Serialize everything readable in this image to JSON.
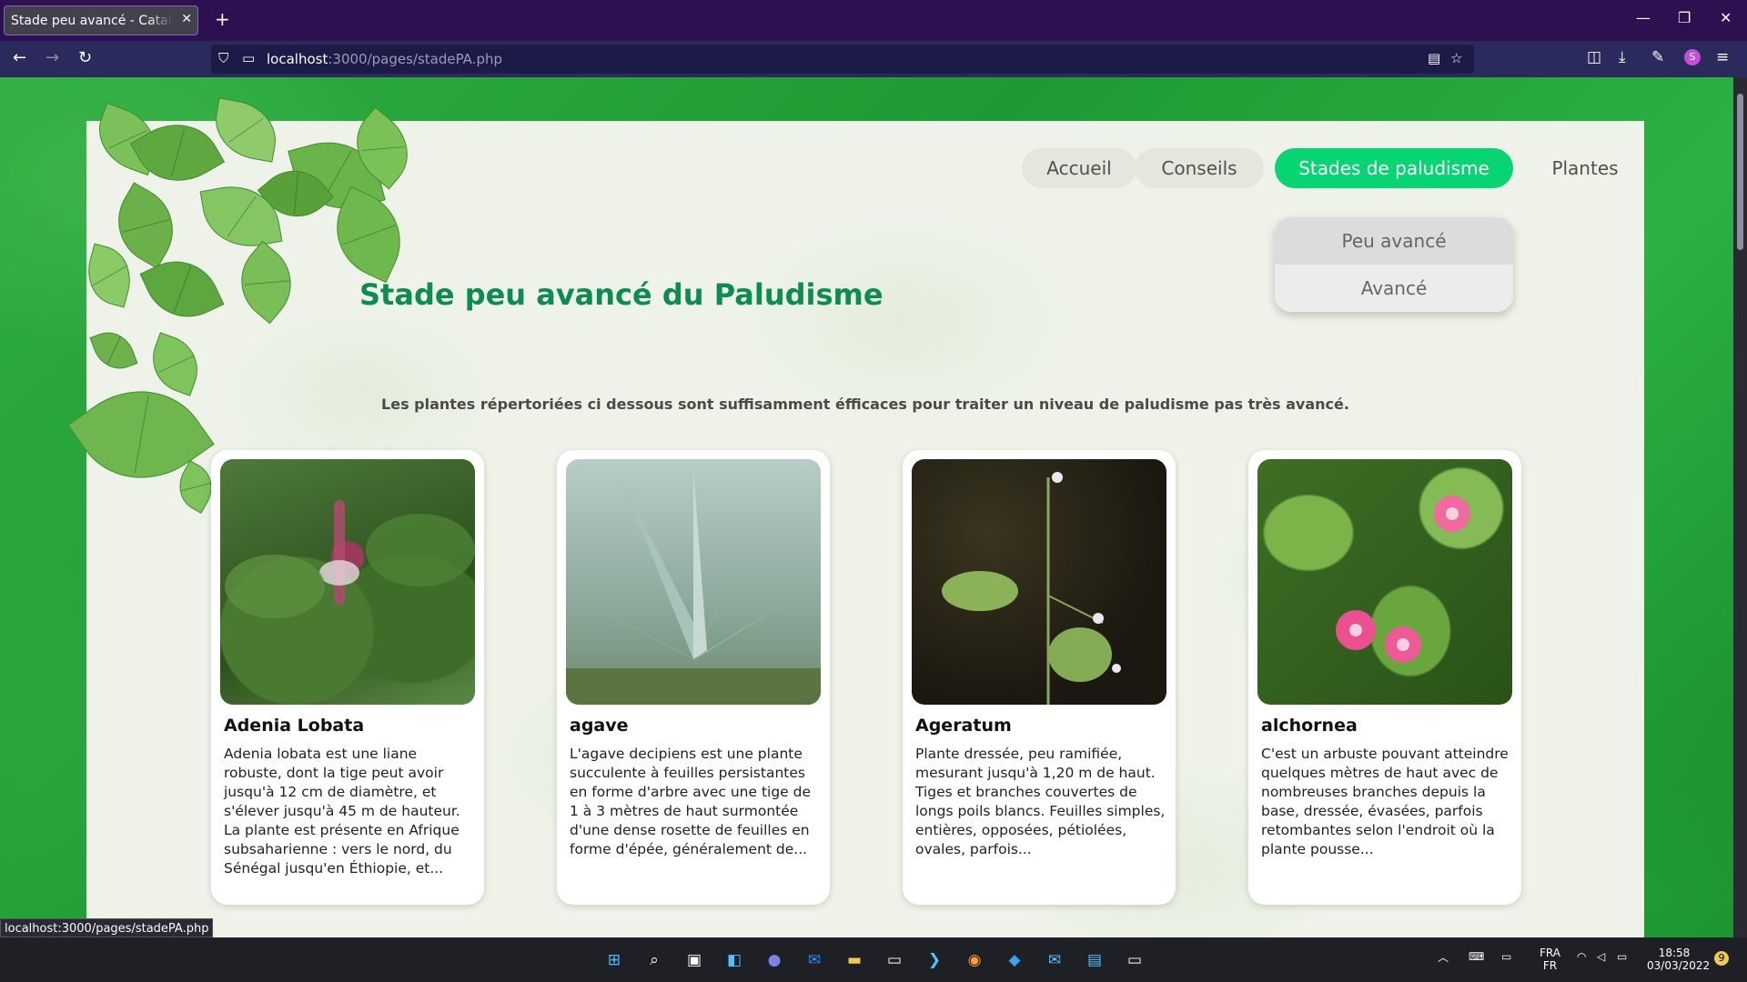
{
  "browser": {
    "tab_title": "Stade peu avancé - Catalogue",
    "url_host": "localhost",
    "url_path": ":3000/pages/stadePA.php",
    "status_url": "localhost:3000/pages/stadePA.php"
  },
  "nav": {
    "items": [
      {
        "label": "Accueil"
      },
      {
        "label": "Conseils"
      },
      {
        "label": "Stades de paludisme"
      },
      {
        "label": "Plantes"
      }
    ],
    "dropdown": [
      {
        "label": "Peu avancé"
      },
      {
        "label": "Avancé"
      }
    ]
  },
  "page": {
    "title": "Stade peu avancé du Paludisme",
    "intro": "Les plantes répertoriées ci dessous sont suffisamment éfficaces pour traiter un niveau de paludisme pas très avancé."
  },
  "cards": [
    {
      "title": "Adenia Lobata",
      "description": "Adenia lobata est une liane robuste, dont la tige peut avoir jusqu'à 12 cm de diamètre, et s'élever jusqu'à 45 m de hauteur. La plante est présente en Afrique subsaharienne : vers le nord, du Sénégal jusqu'en Éthiopie, et...",
      "image_colors": [
        "#2f5a22",
        "#6b3a4a"
      ]
    },
    {
      "title": "agave",
      "description": "L'agave decipiens est une plante succulente à feuilles persistantes en forme d'arbre avec une tige de 1 à 3 mètres de haut surmontée d'une dense rosette de feuilles en forme d'épée, généralement de...",
      "image_colors": [
        "#9fb8b0",
        "#4e6a52"
      ]
    },
    {
      "title": "Ageratum",
      "description": "Plante dressée, peu ramifiée, mesurant jusqu'à 1,20 m de haut. Tiges et branches couvertes de longs poils blancs. Feuilles simples, entières, opposées, pétiolées, ovales, parfois...",
      "image_colors": [
        "#1c1a14",
        "#7aa04a"
      ]
    },
    {
      "title": "alchornea",
      "description": "C'est un arbuste pouvant atteindre quelques mètres de haut avec de nombreuses branches depuis la base, dressée, évasées, parfois retombantes selon l'endroit où la plante pousse...",
      "image_colors": [
        "#2d5a1e",
        "#e8508a"
      ]
    }
  ],
  "taskbar": {
    "lang_top": "FRA",
    "lang_bottom": "FR",
    "time": "18:58",
    "date": "03/03/2022",
    "notifications": "9"
  },
  "colors": {
    "accent": "#07d472",
    "heading": "#0d8c52"
  }
}
